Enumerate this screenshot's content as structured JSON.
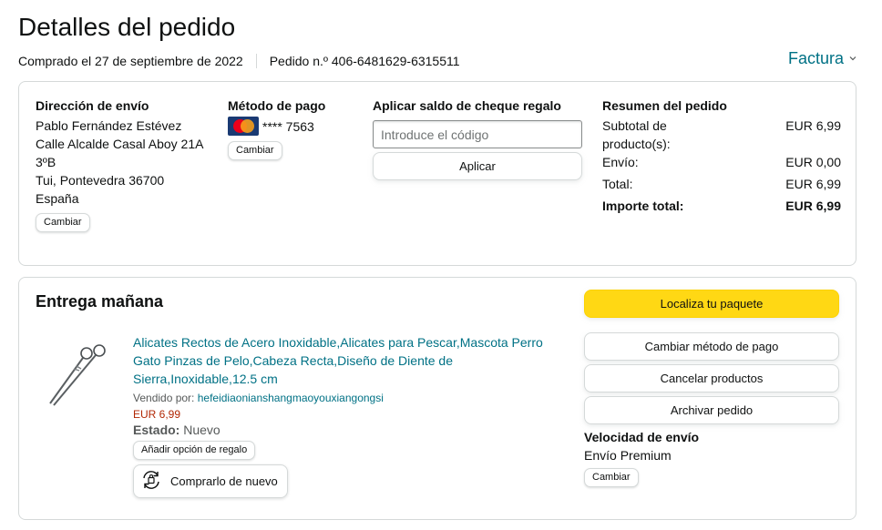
{
  "header": {
    "title": "Detalles del pedido",
    "purchased": "Comprado el 27 de septiembre de 2022",
    "order_number": "Pedido n.º 406-6481629-6315511",
    "invoice_label": "Factura"
  },
  "shipping": {
    "heading": "Dirección de envío",
    "name": "Pablo Fernández Estévez",
    "line1": "Calle Alcalde Casal Aboy 21A",
    "line2": "3ºB",
    "city": "Tui, Pontevedra 36700",
    "country": "España",
    "change_label": "Cambiar"
  },
  "payment": {
    "heading": "Método de pago",
    "card_brand": "MasterCard",
    "card_mask": "**** 7563",
    "change_label": "Cambiar"
  },
  "gift_card": {
    "heading": "Aplicar saldo de cheque regalo",
    "placeholder": "Introduce el código",
    "apply_label": "Aplicar"
  },
  "summary": {
    "heading": "Resumen del pedido",
    "subtotal_label": "Subtotal de producto(s):",
    "subtotal_value": "EUR 6,99",
    "shipping_label": "Envío:",
    "shipping_value": "EUR 0,00",
    "total_label": "Total:",
    "total_value": "EUR 6,99",
    "grand_label": "Importe total:",
    "grand_value": "EUR 6,99"
  },
  "delivery": {
    "title": "Entrega mañana",
    "product_title": "Alicates Rectos de Acero Inoxidable,Alicates para Pescar,Mascota Perro Gato Pinzas de Pelo,Cabeza Recta,Diseño de Diente de Sierra,Inoxidable,12.5 cm",
    "sold_by_label": "Vendido por:",
    "seller": "hefeidiaonianshangmaoyouxiangongsi",
    "price": "EUR 6,99",
    "condition_label": "Estado:",
    "condition_value": "Nuevo",
    "gift_option_label": "Añadir opción de regalo",
    "buy_again_label": "Comprarlo de nuevo"
  },
  "actions": {
    "track": "Localiza tu paquete",
    "change_payment": "Cambiar método de pago",
    "cancel": "Cancelar productos",
    "archive": "Archivar pedido",
    "speed_heading": "Velocidad de envío",
    "speed_value": "Envío Premium",
    "speed_change": "Cambiar"
  },
  "colors": {
    "link": "#007185",
    "price": "#b12704",
    "primary_button": "#ffd814"
  },
  "icons": [
    "chevron-down-icon",
    "mastercard-logo-icon",
    "buy-again-icon"
  ]
}
